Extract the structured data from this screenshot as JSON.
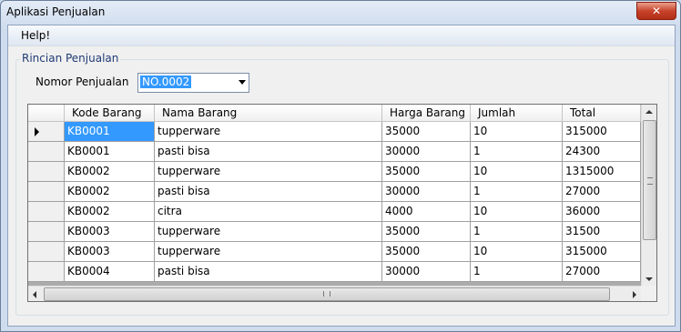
{
  "window": {
    "title": "Aplikasi Penjualan",
    "close_glyph": "✕"
  },
  "menu": {
    "help_label": "Help!"
  },
  "group": {
    "legend": "Rincian Penjualan"
  },
  "form": {
    "nomor_label": "Nomor Penjualan",
    "nomor_value": "NO.0002"
  },
  "grid": {
    "columns": [
      "Kode Barang",
      "Nama Barang",
      "Harga Barang",
      "Jumlah",
      "Total"
    ],
    "rows": [
      [
        "KB0001",
        "tupperware",
        "35000",
        "10",
        "315000"
      ],
      [
        "KB0001",
        "pasti bisa",
        "30000",
        "1",
        "24300"
      ],
      [
        "KB0002",
        "tupperware",
        "35000",
        "10",
        "1315000"
      ],
      [
        "KB0002",
        "pasti bisa",
        "30000",
        "1",
        "27000"
      ],
      [
        "KB0002",
        "citra",
        "4000",
        "10",
        "36000"
      ],
      [
        "KB0003",
        "tupperware",
        "35000",
        "1",
        "31500"
      ],
      [
        "KB0003",
        "tupperware",
        "35000",
        "10",
        "315000"
      ],
      [
        "KB0004",
        "pasti bisa",
        "30000",
        "1",
        "27000"
      ]
    ],
    "current_row": 0,
    "selected_color": "#3399ff"
  }
}
